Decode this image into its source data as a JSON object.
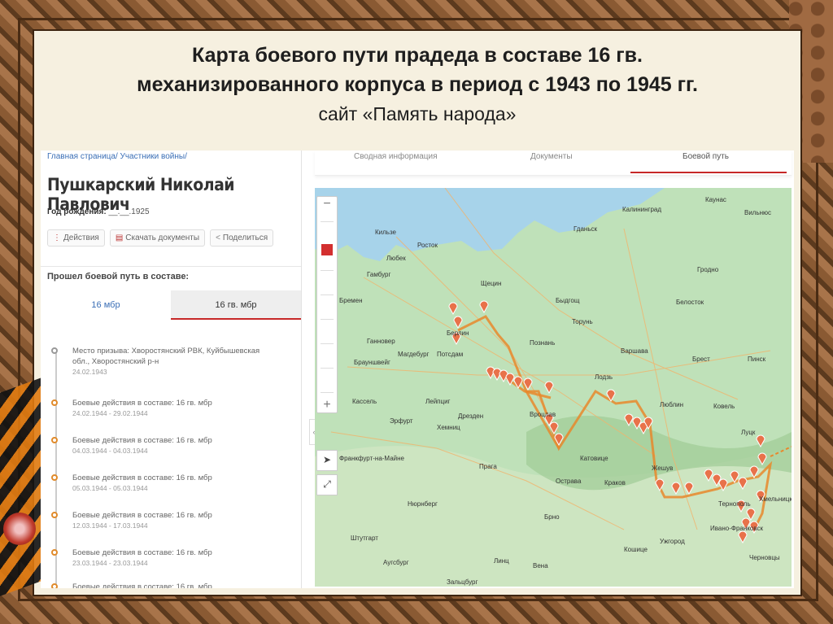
{
  "slide": {
    "title_line1": "Карта боевого пути прадеда в составе  16 гв.",
    "title_line2": "механизированного корпуса в период  с 1943 по 1945 гг.",
    "title_line3": "сайт «Память народа»"
  },
  "profile": {
    "breadcrumb": "Главная страница/ Участники войны/",
    "name": "Пушкарский Николай Павлович",
    "birth_label": "Год рождения:",
    "birth_value": "__.__.1925",
    "actions": [
      "Действия",
      "Скачать документы",
      "Поделиться"
    ],
    "passed_label": "Прошел боевой путь в составе:",
    "units": [
      "16 мбр",
      "16 гв. мбр"
    ]
  },
  "timeline": [
    {
      "text": "Место призыва: Хворостянский РВК, Куйбышевская обл., Хворостянский р-н",
      "date": "24.02.1943"
    },
    {
      "text": "Боевые действия в составе: 16 гв. мбр",
      "date": "24.02.1944 - 29.02.1944"
    },
    {
      "text": "Боевые действия в составе: 16 гв. мбр",
      "date": "04.03.1944 - 04.03.1944"
    },
    {
      "text": "Боевые действия в составе: 16 гв. мбр",
      "date": "05.03.1944 - 05.03.1944"
    },
    {
      "text": "Боевые действия в составе: 16 гв. мбр",
      "date": "12.03.1944 - 17.03.1944"
    },
    {
      "text": "Боевые действия в составе: 16 гв. мбр",
      "date": "23.03.1944 - 23.03.1944"
    },
    {
      "text": "Боевые действия в составе: 16 гв. мбр",
      "date": ""
    }
  ],
  "right_tabs": {
    "summary": "Сводная информация",
    "documents": "Документы",
    "path": "Боевой путь"
  },
  "map": {
    "cities": [
      {
        "name": "Каунас"
      },
      {
        "name": "Вильнюс"
      },
      {
        "name": "Калининград"
      },
      {
        "name": "Гданьск"
      },
      {
        "name": "Кильзе"
      },
      {
        "name": "Росток"
      },
      {
        "name": "Любек"
      },
      {
        "name": "Гамбург"
      },
      {
        "name": "Щецин"
      },
      {
        "name": "Бремен"
      },
      {
        "name": "Ганновер"
      },
      {
        "name": "Берлин"
      },
      {
        "name": "Потсдам"
      },
      {
        "name": "Магдебург"
      },
      {
        "name": "Брауншвейг"
      },
      {
        "name": "Быдгощ"
      },
      {
        "name": "Торунь"
      },
      {
        "name": "Познань"
      },
      {
        "name": "Варшава"
      },
      {
        "name": "Белосток"
      },
      {
        "name": "Гродно"
      },
      {
        "name": "Брест"
      },
      {
        "name": "Пинск"
      },
      {
        "name": "Лодзь"
      },
      {
        "name": "Люблин"
      },
      {
        "name": "Ковель"
      },
      {
        "name": "Луцк"
      },
      {
        "name": "Кассель"
      },
      {
        "name": "Лейпциг"
      },
      {
        "name": "Эрфурт"
      },
      {
        "name": "Дрезден"
      },
      {
        "name": "Хемниц"
      },
      {
        "name": "Вроцлав"
      },
      {
        "name": "Катовице"
      },
      {
        "name": "Краков"
      },
      {
        "name": "Жешув"
      },
      {
        "name": "Прага"
      },
      {
        "name": "Острава"
      },
      {
        "name": "Франкфурт-на-Майне"
      },
      {
        "name": "Нюрнберг"
      },
      {
        "name": "Брно"
      },
      {
        "name": "Штутгарт"
      },
      {
        "name": "Аугсбург"
      },
      {
        "name": "Зальцбург"
      },
      {
        "name": "Линц"
      },
      {
        "name": "Вена"
      },
      {
        "name": "Ивано-Франковск"
      },
      {
        "name": "Тернополь"
      },
      {
        "name": "Хмельницкий"
      },
      {
        "name": "Черновцы"
      },
      {
        "name": "Ужгород"
      },
      {
        "name": "Кошице"
      }
    ]
  },
  "colors": {
    "route": "#e8882c",
    "marker": "#e8724a",
    "accent": "#c62828"
  }
}
